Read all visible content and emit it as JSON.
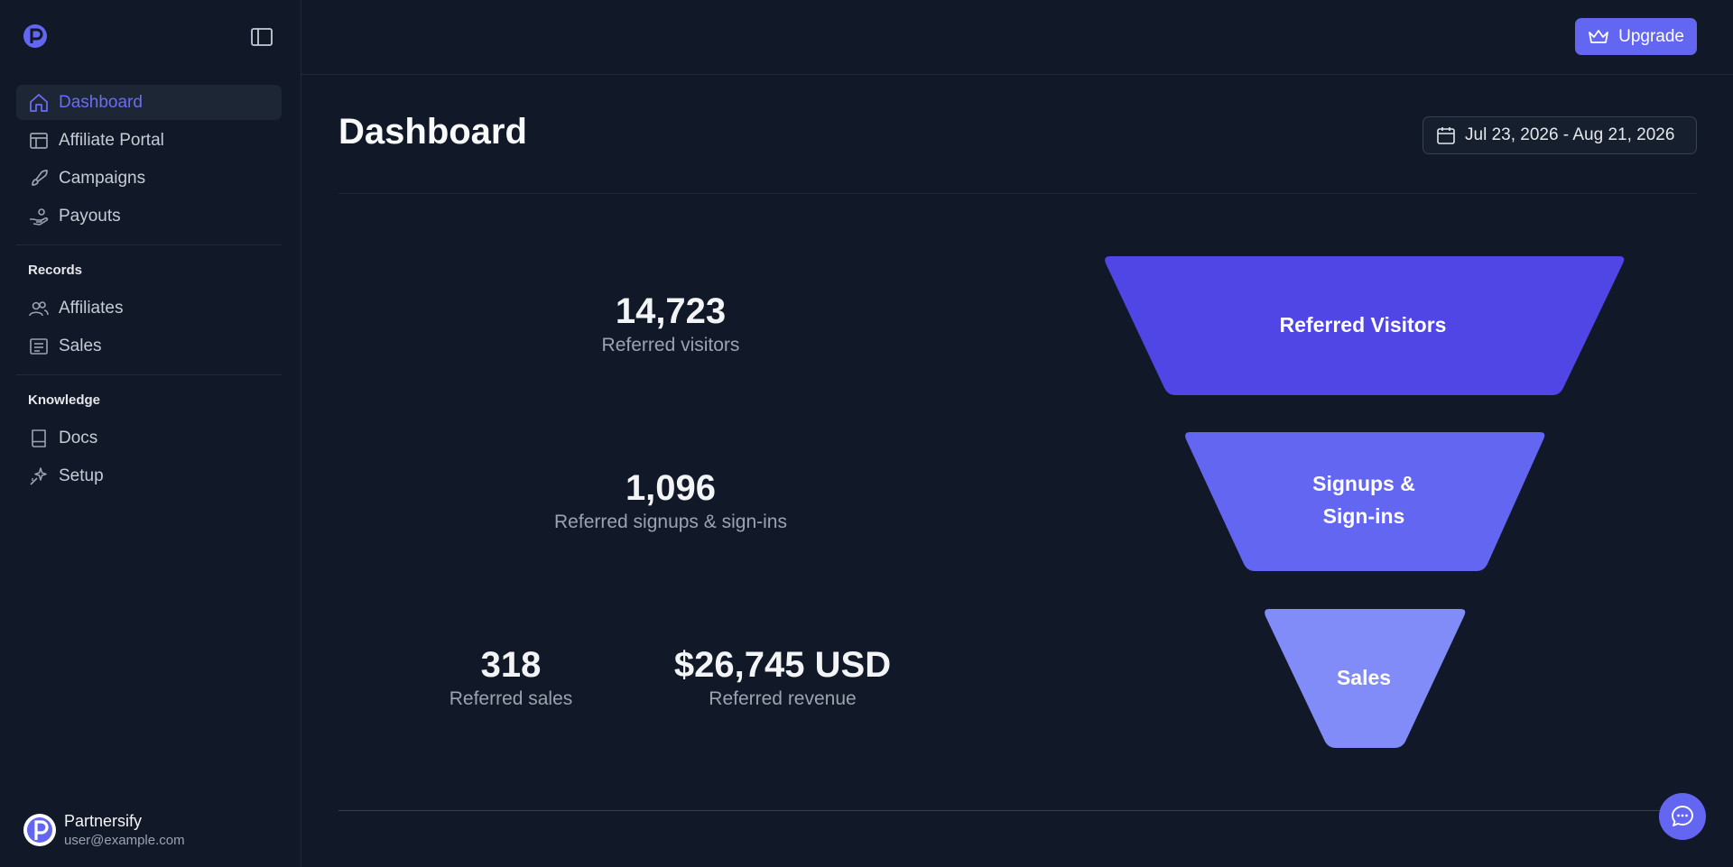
{
  "sidebar": {
    "nav": [
      {
        "label": "Dashboard",
        "icon": "home-icon"
      },
      {
        "label": "Affiliate Portal",
        "icon": "layout-icon"
      },
      {
        "label": "Campaigns",
        "icon": "rocket-icon"
      },
      {
        "label": "Payouts",
        "icon": "hand-coins-icon"
      }
    ],
    "records_heading": "Records",
    "records": [
      {
        "label": "Affiliates",
        "icon": "users-icon"
      },
      {
        "label": "Sales",
        "icon": "receipt-icon"
      }
    ],
    "knowledge_heading": "Knowledge",
    "knowledge": [
      {
        "label": "Docs",
        "icon": "book-icon"
      },
      {
        "label": "Setup",
        "icon": "sparkle-icon"
      }
    ],
    "user": {
      "name": "Partnersify",
      "email": "user@example.com"
    }
  },
  "topbar": {
    "upgrade_label": "Upgrade"
  },
  "main": {
    "title": "Dashboard",
    "date_range": "Jul 23, 2026 - Aug 21, 2026",
    "stats": {
      "visitors": {
        "value": "14,723",
        "label": "Referred visitors"
      },
      "signups": {
        "value": "1,096",
        "label": "Referred signups & sign-ins"
      },
      "sales": {
        "value": "318",
        "label": "Referred sales"
      },
      "revenue": {
        "value": "$26,745 USD",
        "label": "Referred revenue"
      }
    },
    "funnel": {
      "stage1": "Referred Visitors",
      "stage2_line1": "Signups &",
      "stage2_line2": "Sign-ins",
      "stage3": "Sales"
    }
  },
  "colors": {
    "accent": "#6366f1",
    "funnel1": "#4f46e5",
    "funnel2": "#6366f1",
    "funnel3": "#818cf8",
    "background": "#111827"
  }
}
